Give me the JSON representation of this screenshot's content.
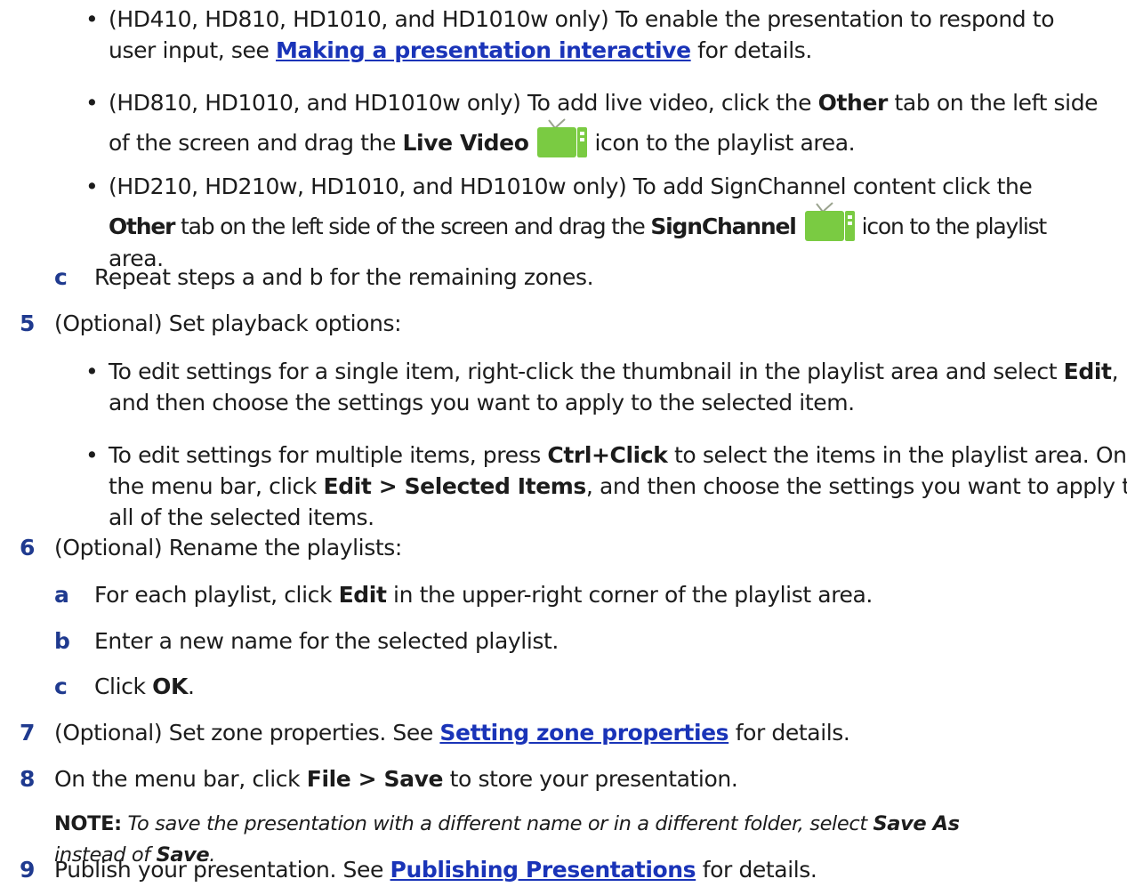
{
  "colors": {
    "step_number": "#1f3a8f",
    "link": "#1a34b8",
    "icon_tv": "#7acb42"
  },
  "bullets_top": [
    {
      "pre": "(HD410, HD810, HD1010, and HD1010w only) To enable the presentation to respond to",
      "line2_pre": "user input, see ",
      "link": "Making a presentation interactive",
      "post": " for details."
    },
    {
      "pre": "(HD810, HD1010, and HD1010w only) To add live video, click the ",
      "b1": "Other",
      "mid": " tab on the left side",
      "line2_pre": "of the screen and drag the ",
      "b2": "Live Video",
      "post": "icon to the playlist area.",
      "icon": "tv-icon"
    },
    {
      "line1": "(HD210, HD210w, HD1010, and HD1010w only) To add SignChannel content click the",
      "b1": "Other",
      "mid": " tab on the left side of the screen and drag the ",
      "b2": "SignChannel",
      "post": "icon to the playlist",
      "line3": "area.",
      "icon": "tv-icon"
    }
  ],
  "step4c": {
    "label": "c",
    "text": "Repeat steps a and b for the remaining zones."
  },
  "step5": {
    "num": "5",
    "text": "(Optional) Set playback options:",
    "b1": {
      "pre": "To edit settings for a single item, right-click the thumbnail in the playlist area and select ",
      "bold": "Edit",
      "post": ",",
      "line2": "and then choose the settings you want to apply to the selected item."
    },
    "b2": {
      "pre": "To edit settings for multiple items, press ",
      "bold": "Ctrl+Click",
      "post": " to select the items in the playlist area. On",
      "line2_pre": "the menu bar, click ",
      "bold2": "Edit > Selected Items",
      "line2_post": ", and then choose the settings you want to apply to",
      "line3": "all of the selected items."
    }
  },
  "step6": {
    "num": "6",
    "text": "(Optional) Rename the playlists:",
    "a": {
      "label": "a",
      "pre": "For each playlist, click ",
      "bold": "Edit",
      "post": " in the upper-right corner of the playlist area."
    },
    "b": {
      "label": "b",
      "text": "Enter a new name for the selected playlist."
    },
    "c": {
      "label": "c",
      "pre": "Click ",
      "bold": "OK",
      "post": "."
    }
  },
  "step7": {
    "num": "7",
    "pre": "(Optional) Set zone properties. See ",
    "link": "Setting zone properties",
    "post": " for details."
  },
  "step8": {
    "num": "8",
    "pre": "On the menu bar, click ",
    "bold": "File > Save",
    "post": " to store your presentation.",
    "note_label": "NOTE:",
    "note_pre": " To save the presentation with a different name or in a different folder, select ",
    "note_b1": "Save As",
    "note_line2": "instead of ",
    "note_b2": "Save",
    "note_end": "."
  },
  "step9": {
    "num": "9",
    "pre": "Publish your presentation. See ",
    "link": "Publishing Presentations",
    "post": " for details."
  }
}
